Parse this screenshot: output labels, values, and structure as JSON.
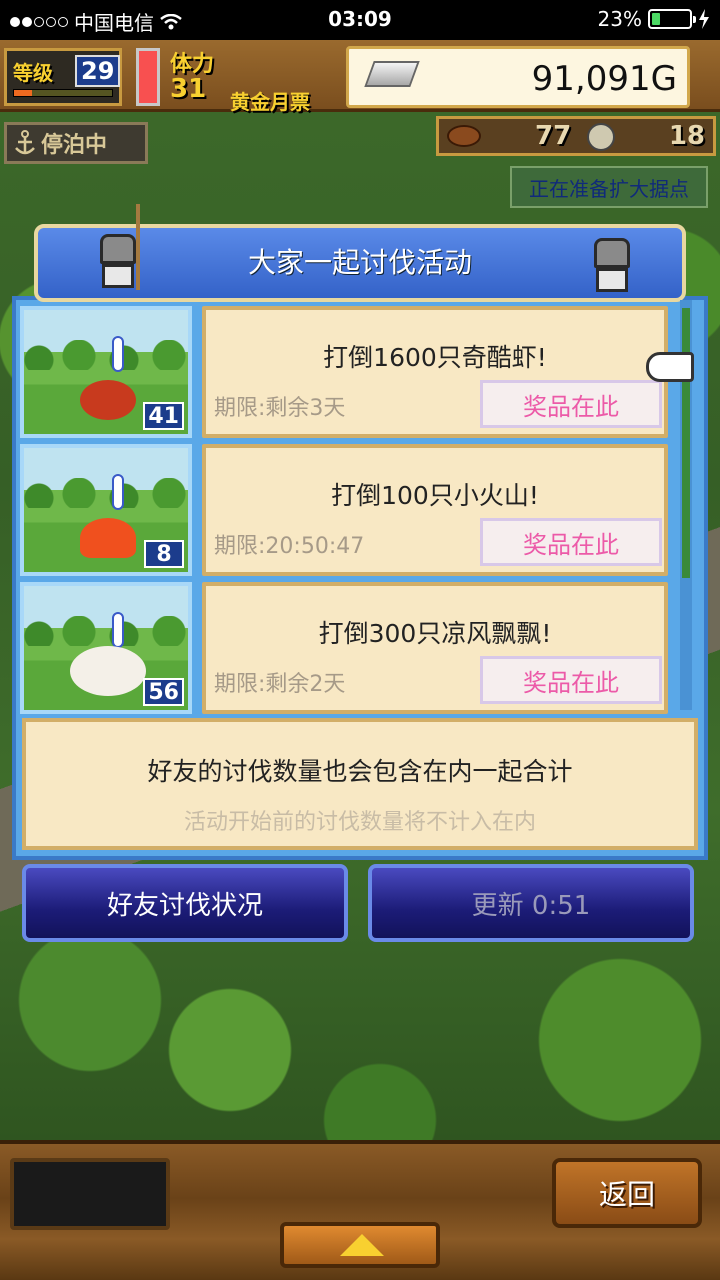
{
  "status_bar": {
    "carrier": "中国电信",
    "time": "03:09",
    "battery": "23%",
    "signal_dots_on": 2,
    "signal_dots_total": 5,
    "battery_level": 0.23
  },
  "hud": {
    "level_label": "等级",
    "level_value": "29",
    "stamina_label": "体力",
    "stamina_value": "31",
    "gold_ticket_label": "黄金月票",
    "gold_amount": "91,091G",
    "docked_label": "停泊中",
    "resource1_value": "77",
    "resource2_value": "18",
    "notice": "正在准备扩大据点"
  },
  "dialog": {
    "title": "大家一起讨伐活动",
    "quests": [
      {
        "title": "打倒1600只奇酷虾!",
        "deadline": "期限:剩余3天",
        "reward_label": "奖品在此",
        "count": "41",
        "monster_color": "#c83a1e"
      },
      {
        "title": "打倒100只小火山!",
        "deadline": "期限:20:50:47",
        "reward_label": "奖品在此",
        "count": "8",
        "monster_color": "#f0501e"
      },
      {
        "title": "打倒300只凉风飘飘!",
        "deadline": "期限:剩余2天",
        "reward_label": "奖品在此",
        "count": "56",
        "monster_color": "#f4f0e8"
      }
    ],
    "info_main": "好友的讨伐数量也会包含在内一起合计",
    "info_sub": "活动开始前的讨伐数量将不计入在内"
  },
  "buttons": {
    "friend_status": "好友讨伐状况",
    "refresh": "更新 0:51",
    "back": "返回"
  },
  "colors": {
    "reward_text": "#ec5aa8",
    "panel_blue": "#5aa8e8",
    "card_bg": "#f8e8c4"
  }
}
